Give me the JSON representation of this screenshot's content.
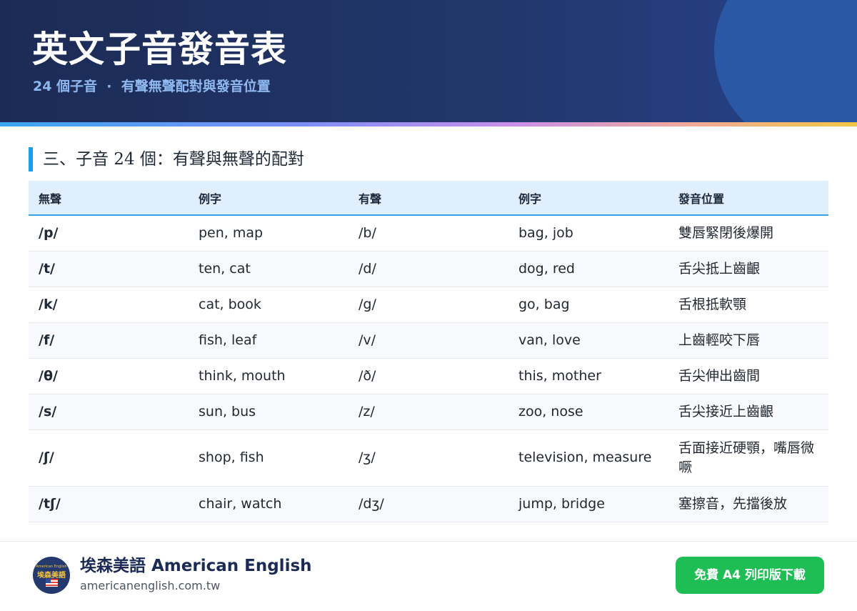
{
  "header": {
    "title": "英文子音發音表",
    "subtitle": "24 個子音  ·  有聲無聲配對與發音位置"
  },
  "section": {
    "title": "三、子音 24 個：有聲與無聲的配對"
  },
  "table": {
    "columns": [
      "無聲",
      "例字",
      "有聲",
      "例字",
      "發音位置"
    ],
    "rows": [
      {
        "voiceless": "/p/",
        "voiceless_examples": "pen, map",
        "voiced": "/b/",
        "voiced_examples": "bag, job",
        "position": "雙唇緊閉後爆開"
      },
      {
        "voiceless": "/t/",
        "voiceless_examples": "ten, cat",
        "voiced": "/d/",
        "voiced_examples": "dog, red",
        "position": "舌尖抵上齒齦"
      },
      {
        "voiceless": "/k/",
        "voiceless_examples": "cat, book",
        "voiced": "/g/",
        "voiced_examples": "go, bag",
        "position": "舌根抵軟顎"
      },
      {
        "voiceless": "/f/",
        "voiceless_examples": "fish, leaf",
        "voiced": "/v/",
        "voiced_examples": "van, love",
        "position": "上齒輕咬下唇"
      },
      {
        "voiceless": "/θ/",
        "voiceless_examples": "think, mouth",
        "voiced": "/ð/",
        "voiced_examples": "this, mother",
        "position": "舌尖伸出齒間"
      },
      {
        "voiceless": "/s/",
        "voiceless_examples": "sun, bus",
        "voiced": "/z/",
        "voiced_examples": "zoo, nose",
        "position": "舌尖接近上齒齦"
      },
      {
        "voiceless": "/ʃ/",
        "voiceless_examples": "shop, fish",
        "voiced": "/ʒ/",
        "voiced_examples": "television, measure",
        "position": "舌面接近硬顎，嘴唇微噘"
      },
      {
        "voiceless": "/tʃ/",
        "voiceless_examples": "chair, watch",
        "voiced": "/dʒ/",
        "voiced_examples": "jump, bridge",
        "position": "塞擦音，先擋後放"
      }
    ]
  },
  "footer": {
    "logo_text_small": "American English",
    "logo_text": "埃森美語",
    "brand_name": "埃森美語 American English",
    "url": "americanenglish.com.tw",
    "download_label": "免費 A4 列印版下載"
  }
}
